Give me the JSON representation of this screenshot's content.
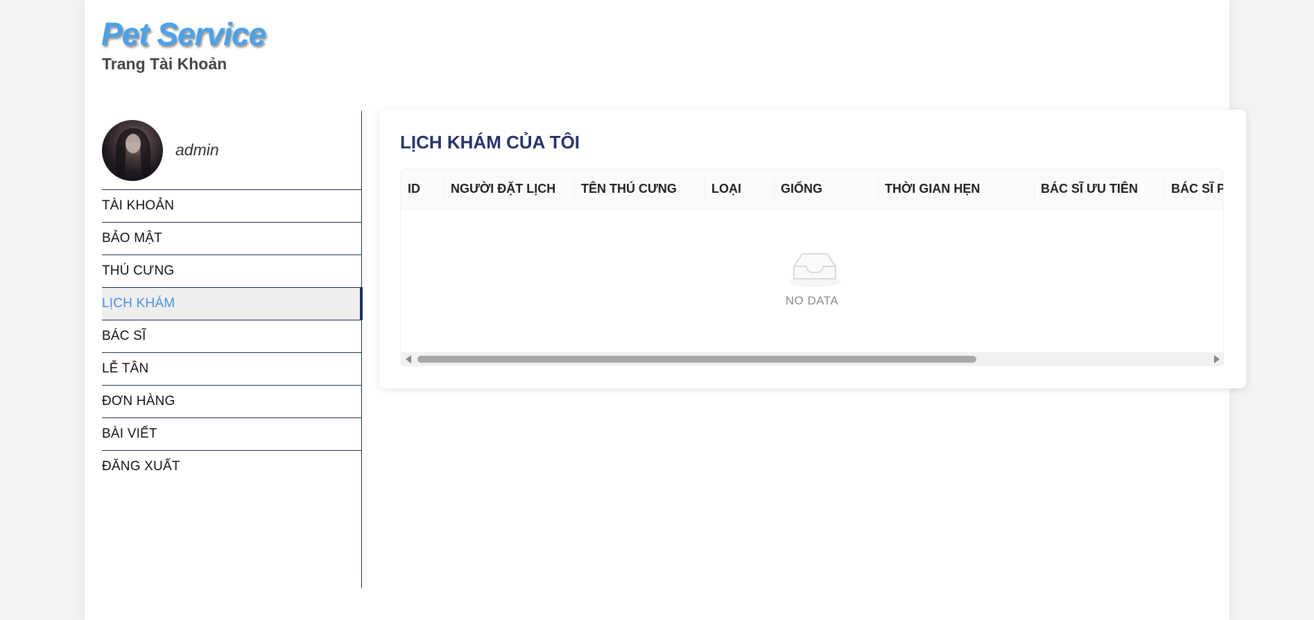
{
  "header": {
    "brand": "Pet Service",
    "subtitle": "Trang Tài Khoản"
  },
  "profile": {
    "username": "admin"
  },
  "menu": [
    {
      "label": "TÀI KHOẢN",
      "active": false
    },
    {
      "label": "BẢO MẬT",
      "active": false
    },
    {
      "label": "THÚ CƯNG",
      "active": false
    },
    {
      "label": "LỊCH KHÁM",
      "active": true
    },
    {
      "label": "BÁC SĨ",
      "active": false
    },
    {
      "label": "LỄ TÂN",
      "active": false
    },
    {
      "label": "ĐƠN HÀNG",
      "active": false
    },
    {
      "label": "BÀI VIẾT",
      "active": false
    },
    {
      "label": "ĐĂNG XUẤT",
      "active": false
    }
  ],
  "panel": {
    "title": "LỊCH KHÁM CỦA TÔI",
    "columns": [
      "ID",
      "NGƯỜI ĐẶT LỊCH",
      "TÊN THÚ CƯNG",
      "LOẠI",
      "GIỐNG",
      "THỜI GIAN HẸN",
      "BÁC SĨ ƯU TIÊN",
      "BÁC SĨ PH"
    ],
    "empty_text": "NO DATA"
  },
  "colors": {
    "brand": "#4aa2ea",
    "title": "#26346b",
    "active_menu": "#4a90e2",
    "divider": "#1f2d5c"
  }
}
